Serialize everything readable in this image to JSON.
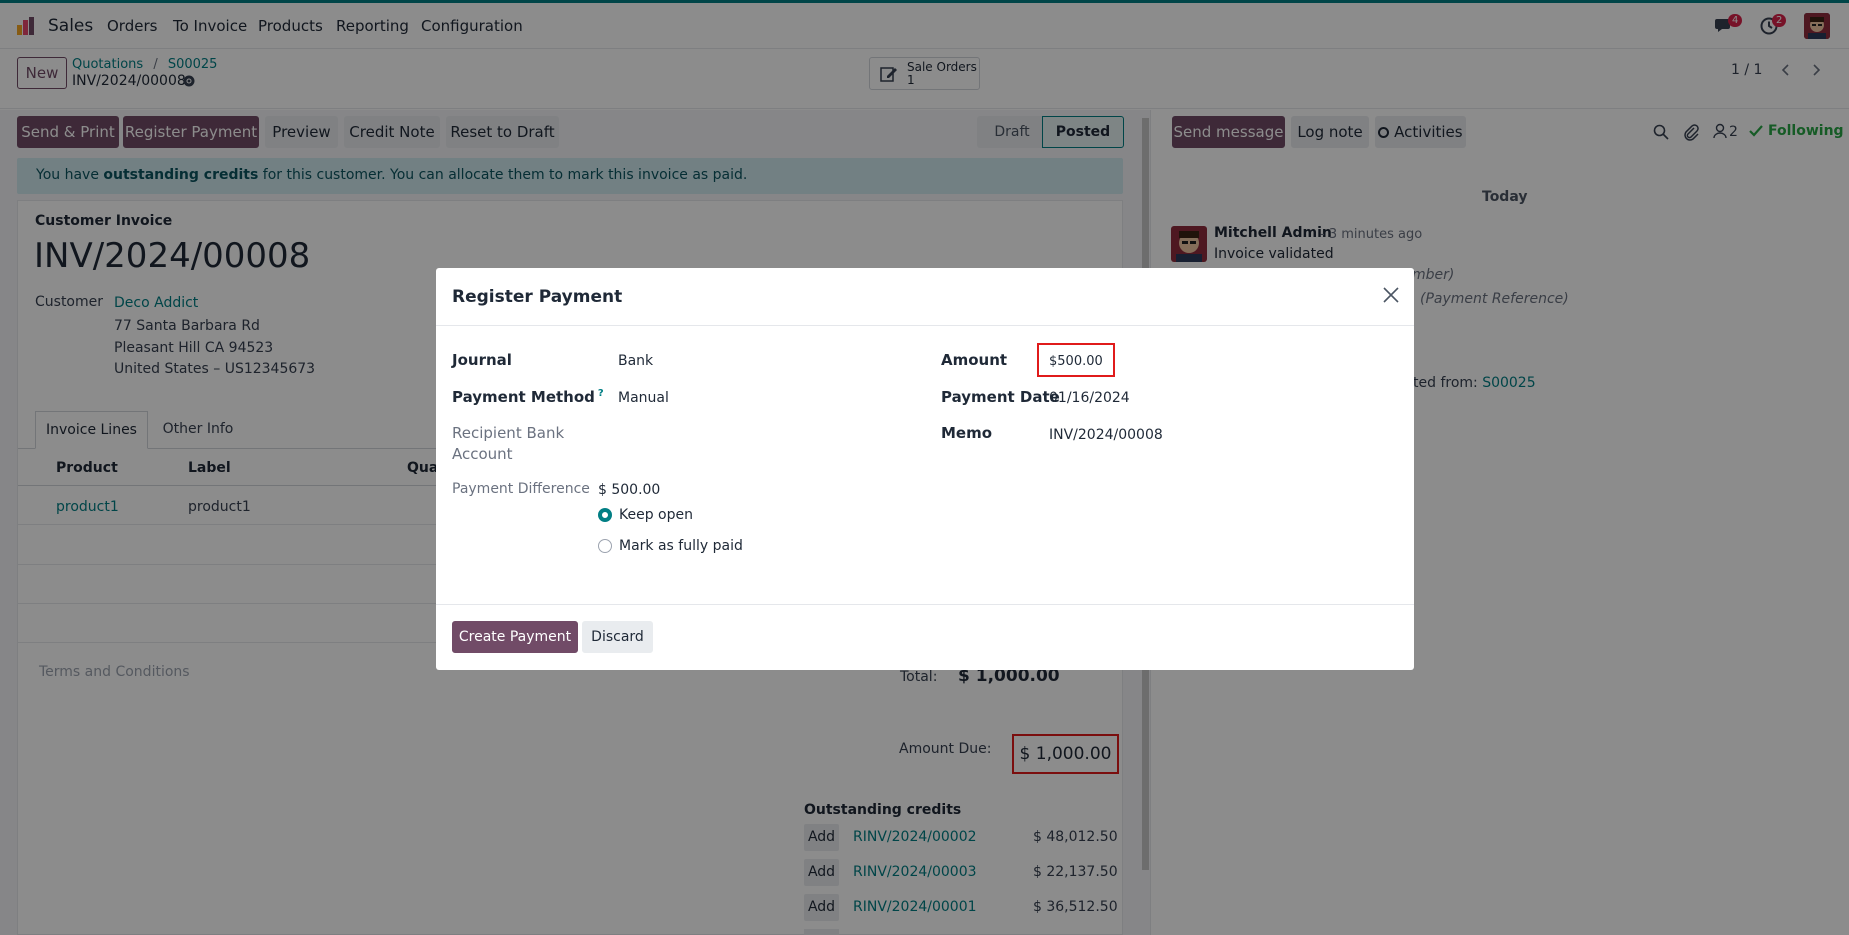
{
  "nav": {
    "app_name": "Sales",
    "menu": [
      "Orders",
      "To Invoice",
      "Products",
      "Reporting",
      "Configuration"
    ],
    "messages_count": "4",
    "activities_count": "2"
  },
  "control": {
    "new_label": "New",
    "breadcrumb": [
      "Quotations",
      "S00025"
    ],
    "record_name": "INV/2024/00008",
    "smart_button_label": "Sale Orders",
    "smart_button_count": "1",
    "pager": "1 / 1"
  },
  "toolbar": {
    "buttons": [
      "Send & Print",
      "Register Payment",
      "Preview",
      "Credit Note",
      "Reset to Draft"
    ],
    "status": [
      "Draft",
      "Posted"
    ],
    "active_status": "Posted"
  },
  "alert": {
    "prefix": "You have ",
    "bold": "outstanding credits",
    "suffix": " for this customer. You can allocate them to mark this invoice as paid."
  },
  "invoice": {
    "type_label": "Customer Invoice",
    "number": "INV/2024/00008",
    "customer_label": "Customer",
    "customer_name": "Deco Addict",
    "address": [
      "77 Santa Barbara Rd",
      "Pleasant Hill CA 94523",
      "United States – US12345673"
    ],
    "tabs": [
      "Invoice Lines",
      "Other Info"
    ],
    "columns": [
      "Product",
      "Label",
      "Quan"
    ],
    "lines": [
      {
        "product": "product1",
        "label": "product1"
      }
    ],
    "terms_placeholder": "Terms and Conditions",
    "total_label": "Total:",
    "total_value": "$ 1,000.00",
    "amount_due_label": "Amount Due:",
    "amount_due_value": "$ 1,000.00",
    "outstanding_title": "Outstanding credits",
    "outstanding": [
      {
        "action": "Add",
        "ref": "RINV/2024/00002",
        "amount": "$ 48,012.50"
      },
      {
        "action": "Add",
        "ref": "RINV/2024/00003",
        "amount": "$ 22,137.50"
      },
      {
        "action": "Add",
        "ref": "RINV/2024/00001",
        "amount": "$ 36,512.50"
      }
    ]
  },
  "chatter": {
    "send_message": "Send message",
    "log_note": "Log note",
    "activities": "Activities",
    "followers_count": "2",
    "following": "Following",
    "date_separator": "Today",
    "author": "Mitchell Admin",
    "time": "- 3 minutes ago",
    "body": "Invoice validated",
    "partial_1": "mber)",
    "partial_2": "(Payment Reference)",
    "partial_3": "ted from:",
    "partial_3_link": "S00025"
  },
  "modal": {
    "title": "Register Payment",
    "journal_label": "Journal",
    "journal_value": "Bank",
    "payment_method_label": "Payment Method",
    "payment_method_help": "?",
    "payment_method_value": "Manual",
    "recipient_label_1": "Recipient Bank",
    "recipient_label_2": "Account",
    "payment_difference_label": "Payment Difference",
    "payment_difference_value": "$ 500.00",
    "options": [
      "Keep open",
      "Mark as fully paid"
    ],
    "selected_option": "Keep open",
    "amount_label": "Amount",
    "amount_value": "$500.00",
    "payment_date_label": "Payment Date",
    "payment_date_value": "01/16/2024",
    "memo_label": "Memo",
    "memo_value": "INV/2024/00008",
    "create_label": "Create Payment",
    "discard_label": "Discard"
  },
  "colors": {
    "primary": "#714b67",
    "link": "#017e84",
    "highlight_box": "#e01b1b",
    "alert_bg": "#cfe9ee"
  }
}
